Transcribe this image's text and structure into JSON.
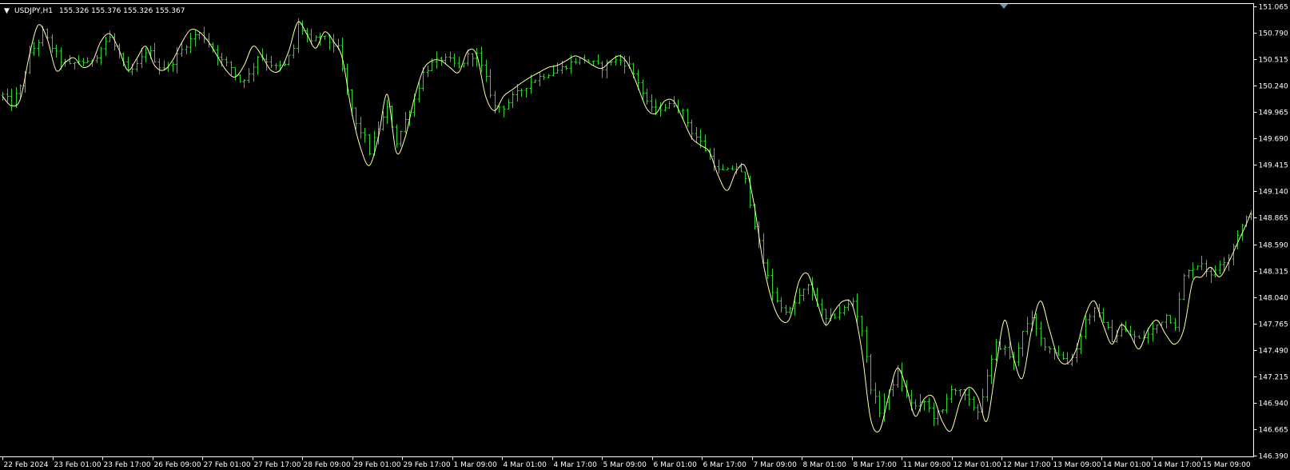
{
  "header": {
    "menu_glyph": "▼",
    "symbol": "USDJPY,H1",
    "ohlc": "155.326 155.376 155.326 155.367"
  },
  "colors": {
    "background": "#000000",
    "bars": "#32cd32",
    "overlay": "#ffffaa",
    "axis": "#ffffff",
    "marker": "#6f8fb8"
  },
  "icons": {
    "menu": "triangle-down-icon",
    "shift_marker": "triangle-down-icon"
  },
  "chart_data": {
    "type": "ohlc",
    "timeframe": "H1",
    "y_axis": {
      "min": 146.39,
      "max": 151.065,
      "ticks": [
        "151.065",
        "150.790",
        "150.515",
        "150.240",
        "149.965",
        "149.690",
        "149.415",
        "149.140",
        "148.865",
        "148.590",
        "148.315",
        "148.040",
        "147.765",
        "147.490",
        "147.215",
        "146.940",
        "146.665",
        "146.390"
      ]
    },
    "x_axis": {
      "labels": [
        "22 Feb 2024",
        "23 Feb 01:00",
        "23 Feb 17:00",
        "26 Feb 09:00",
        "27 Feb 01:00",
        "27 Feb 17:00",
        "28 Feb 09:00",
        "29 Feb 01:00",
        "29 Feb 17:00",
        "1 Mar 09:00",
        "4 Mar 01:00",
        "4 Mar 17:00",
        "5 Mar 09:00",
        "6 Mar 01:00",
        "6 Mar 17:00",
        "7 Mar 09:00",
        "8 Mar 01:00",
        "8 Mar 17:00",
        "11 Mar 09:00",
        "12 Mar 01:00",
        "12 Mar 17:00",
        "13 Mar 09:00",
        "14 Mar 01:00",
        "14 Mar 17:00",
        "15 Mar 09:00"
      ]
    },
    "grid": false,
    "series": [
      {
        "kind": "price-bars",
        "close_path": [
          [
            0,
            150.14
          ],
          [
            2,
            150.06
          ],
          [
            4,
            150.22
          ],
          [
            6,
            150.56
          ],
          [
            8,
            150.7
          ],
          [
            9,
            150.8
          ],
          [
            11,
            150.64
          ],
          [
            13,
            150.5
          ],
          [
            15,
            150.45
          ],
          [
            17,
            150.5
          ],
          [
            19,
            150.47
          ],
          [
            21,
            150.56
          ],
          [
            23,
            150.7
          ],
          [
            24,
            150.74
          ],
          [
            26,
            150.56
          ],
          [
            28,
            150.36
          ],
          [
            30,
            150.45
          ],
          [
            32,
            150.6
          ],
          [
            33,
            150.58
          ],
          [
            35,
            150.44
          ],
          [
            37,
            150.43
          ],
          [
            39,
            150.55
          ],
          [
            41,
            150.67
          ],
          [
            43,
            150.77
          ],
          [
            44,
            150.78
          ],
          [
            45,
            150.74
          ],
          [
            47,
            150.62
          ],
          [
            49,
            150.5
          ],
          [
            51,
            150.43
          ],
          [
            53,
            150.29
          ],
          [
            55,
            150.35
          ],
          [
            57,
            150.55
          ],
          [
            59,
            150.5
          ],
          [
            61,
            150.43
          ],
          [
            63,
            150.45
          ],
          [
            65,
            150.63
          ],
          [
            66,
            150.87
          ],
          [
            68,
            150.77
          ],
          [
            69,
            150.68
          ],
          [
            71,
            150.76
          ],
          [
            73,
            150.7
          ],
          [
            75,
            150.63
          ],
          [
            77,
            150.18
          ],
          [
            79,
            149.83
          ],
          [
            81,
            149.7
          ],
          [
            82,
            149.55
          ],
          [
            84,
            149.8
          ],
          [
            86,
            150.0
          ],
          [
            88,
            149.65
          ],
          [
            90,
            149.88
          ],
          [
            92,
            150.1
          ],
          [
            94,
            150.37
          ],
          [
            96,
            150.47
          ],
          [
            98,
            150.52
          ],
          [
            100,
            150.5
          ],
          [
            102,
            150.43
          ],
          [
            104,
            150.55
          ],
          [
            106,
            150.56
          ],
          [
            108,
            150.31
          ],
          [
            110,
            150.02
          ],
          [
            112,
            150.02
          ],
          [
            114,
            150.12
          ],
          [
            116,
            150.2
          ],
          [
            118,
            150.28
          ],
          [
            120,
            150.33
          ],
          [
            122,
            150.37
          ],
          [
            124,
            150.4
          ],
          [
            126,
            150.45
          ],
          [
            128,
            150.5
          ],
          [
            130,
            150.52
          ],
          [
            132,
            150.47
          ],
          [
            134,
            150.43
          ],
          [
            136,
            150.5
          ],
          [
            138,
            150.5
          ],
          [
            140,
            150.45
          ],
          [
            142,
            150.28
          ],
          [
            144,
            150.05
          ],
          [
            146,
            149.99
          ],
          [
            148,
            150.02
          ],
          [
            150,
            150.05
          ],
          [
            152,
            149.96
          ],
          [
            154,
            149.76
          ],
          [
            156,
            149.65
          ],
          [
            158,
            149.5
          ],
          [
            160,
            149.35
          ],
          [
            162,
            149.35
          ],
          [
            164,
            149.4
          ],
          [
            166,
            149.25
          ],
          [
            168,
            148.8
          ],
          [
            170,
            148.4
          ],
          [
            172,
            148.1
          ],
          [
            174,
            147.92
          ],
          [
            176,
            147.9
          ],
          [
            178,
            148.05
          ],
          [
            180,
            148.15
          ],
          [
            182,
            147.98
          ],
          [
            184,
            147.8
          ],
          [
            186,
            147.85
          ],
          [
            188,
            147.92
          ],
          [
            190,
            148.0
          ],
          [
            192,
            147.7
          ],
          [
            194,
            147.1
          ],
          [
            196,
            146.85
          ],
          [
            198,
            147.05
          ],
          [
            200,
            147.25
          ],
          [
            202,
            147.0
          ],
          [
            204,
            146.9
          ],
          [
            206,
            146.95
          ],
          [
            208,
            146.8
          ],
          [
            210,
            146.85
          ],
          [
            212,
            147.1
          ],
          [
            214,
            147.05
          ],
          [
            216,
            146.95
          ],
          [
            218,
            146.85
          ],
          [
            220,
            147.2
          ],
          [
            222,
            147.55
          ],
          [
            224,
            147.5
          ],
          [
            226,
            147.35
          ],
          [
            228,
            147.7
          ],
          [
            230,
            147.8
          ],
          [
            232,
            147.6
          ],
          [
            234,
            147.5
          ],
          [
            236,
            147.45
          ],
          [
            238,
            147.35
          ],
          [
            240,
            147.5
          ],
          [
            242,
            147.8
          ],
          [
            244,
            147.9
          ],
          [
            246,
            147.8
          ],
          [
            248,
            147.6
          ],
          [
            250,
            147.7
          ],
          [
            252,
            147.65
          ],
          [
            254,
            147.6
          ],
          [
            256,
            147.65
          ],
          [
            258,
            147.75
          ],
          [
            260,
            147.85
          ],
          [
            262,
            147.75
          ],
          [
            264,
            148.25
          ],
          [
            266,
            148.35
          ],
          [
            268,
            148.4
          ],
          [
            270,
            148.25
          ],
          [
            272,
            148.4
          ],
          [
            274,
            148.45
          ],
          [
            276,
            148.7
          ],
          [
            278,
            148.85
          ],
          [
            279,
            148.93
          ]
        ],
        "bar_count": 280
      },
      {
        "kind": "smoothed-overlay",
        "points": [
          [
            0,
            150.13
          ],
          [
            2,
            150.03
          ],
          [
            4,
            150.1
          ],
          [
            6,
            150.55
          ],
          [
            8,
            150.87
          ],
          [
            10,
            150.73
          ],
          [
            12,
            150.4
          ],
          [
            14,
            150.48
          ],
          [
            16,
            150.53
          ],
          [
            18,
            150.43
          ],
          [
            20,
            150.48
          ],
          [
            22,
            150.7
          ],
          [
            24,
            150.78
          ],
          [
            26,
            150.62
          ],
          [
            28,
            150.4
          ],
          [
            30,
            150.52
          ],
          [
            32,
            150.65
          ],
          [
            34,
            150.45
          ],
          [
            36,
            150.4
          ],
          [
            38,
            150.5
          ],
          [
            40,
            150.68
          ],
          [
            42,
            150.82
          ],
          [
            44,
            150.8
          ],
          [
            46,
            150.7
          ],
          [
            48,
            150.55
          ],
          [
            50,
            150.4
          ],
          [
            52,
            150.33
          ],
          [
            54,
            150.45
          ],
          [
            56,
            150.65
          ],
          [
            58,
            150.55
          ],
          [
            60,
            150.4
          ],
          [
            62,
            150.4
          ],
          [
            64,
            150.6
          ],
          [
            66,
            150.9
          ],
          [
            68,
            150.78
          ],
          [
            70,
            150.63
          ],
          [
            72,
            150.8
          ],
          [
            74,
            150.7
          ],
          [
            76,
            150.52
          ],
          [
            78,
            149.98
          ],
          [
            80,
            149.6
          ],
          [
            82,
            149.41
          ],
          [
            84,
            149.7
          ],
          [
            86,
            150.15
          ],
          [
            88,
            149.55
          ],
          [
            90,
            149.7
          ],
          [
            92,
            150.1
          ],
          [
            94,
            150.4
          ],
          [
            96,
            150.5
          ],
          [
            98,
            150.5
          ],
          [
            100,
            150.43
          ],
          [
            102,
            150.38
          ],
          [
            104,
            150.6
          ],
          [
            106,
            150.56
          ],
          [
            108,
            150.13
          ],
          [
            110,
            149.98
          ],
          [
            112,
            150.13
          ],
          [
            114,
            150.2
          ],
          [
            116,
            150.27
          ],
          [
            118,
            150.33
          ],
          [
            120,
            150.38
          ],
          [
            122,
            150.43
          ],
          [
            124,
            150.45
          ],
          [
            126,
            150.5
          ],
          [
            128,
            150.55
          ],
          [
            130,
            150.51
          ],
          [
            132,
            150.45
          ],
          [
            134,
            150.42
          ],
          [
            136,
            150.5
          ],
          [
            138,
            150.55
          ],
          [
            140,
            150.45
          ],
          [
            142,
            150.23
          ],
          [
            144,
            150.0
          ],
          [
            146,
            149.95
          ],
          [
            148,
            150.08
          ],
          [
            150,
            150.08
          ],
          [
            152,
            149.9
          ],
          [
            154,
            149.7
          ],
          [
            156,
            149.62
          ],
          [
            158,
            149.55
          ],
          [
            160,
            149.3
          ],
          [
            162,
            149.15
          ],
          [
            164,
            149.35
          ],
          [
            166,
            149.4
          ],
          [
            168,
            149.0
          ],
          [
            170,
            148.4
          ],
          [
            172,
            148.0
          ],
          [
            174,
            147.8
          ],
          [
            176,
            147.82
          ],
          [
            178,
            148.2
          ],
          [
            180,
            148.28
          ],
          [
            182,
            148.0
          ],
          [
            184,
            147.75
          ],
          [
            186,
            147.9
          ],
          [
            188,
            148.0
          ],
          [
            190,
            147.95
          ],
          [
            192,
            147.5
          ],
          [
            194,
            146.78
          ],
          [
            196,
            146.65
          ],
          [
            198,
            147.0
          ],
          [
            200,
            147.3
          ],
          [
            202,
            147.1
          ],
          [
            204,
            146.8
          ],
          [
            206,
            146.98
          ],
          [
            208,
            147.0
          ],
          [
            210,
            146.75
          ],
          [
            212,
            146.65
          ],
          [
            214,
            146.95
          ],
          [
            216,
            147.1
          ],
          [
            218,
            147.0
          ],
          [
            220,
            146.75
          ],
          [
            222,
            147.3
          ],
          [
            224,
            147.8
          ],
          [
            226,
            147.4
          ],
          [
            228,
            147.2
          ],
          [
            230,
            147.7
          ],
          [
            232,
            148.0
          ],
          [
            234,
            147.7
          ],
          [
            236,
            147.4
          ],
          [
            238,
            147.35
          ],
          [
            240,
            147.5
          ],
          [
            242,
            147.85
          ],
          [
            244,
            148.0
          ],
          [
            246,
            147.75
          ],
          [
            248,
            147.55
          ],
          [
            250,
            147.75
          ],
          [
            252,
            147.65
          ],
          [
            254,
            147.5
          ],
          [
            256,
            147.7
          ],
          [
            258,
            147.8
          ],
          [
            260,
            147.65
          ],
          [
            262,
            147.55
          ],
          [
            264,
            147.7
          ],
          [
            266,
            148.2
          ],
          [
            268,
            148.25
          ],
          [
            270,
            148.35
          ],
          [
            272,
            148.25
          ],
          [
            274,
            148.4
          ],
          [
            276,
            148.6
          ],
          [
            278,
            148.8
          ],
          [
            279,
            148.92
          ]
        ]
      }
    ]
  }
}
